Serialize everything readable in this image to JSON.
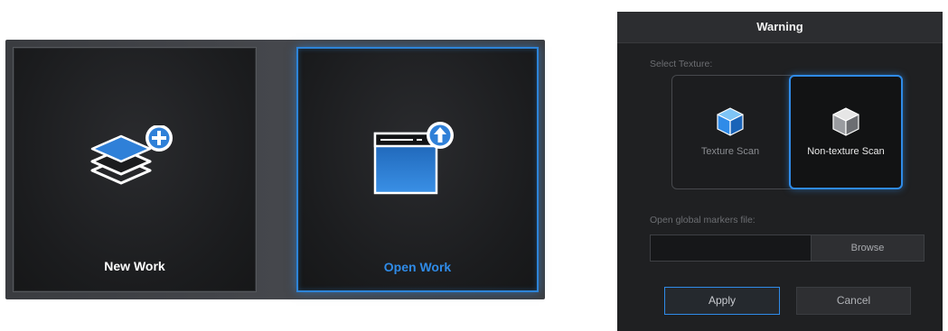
{
  "launcher": {
    "new_work": {
      "label": "New Work",
      "icon": "layers-add-icon"
    },
    "open_work": {
      "label": "Open Work",
      "icon": "window-upload-icon"
    }
  },
  "dialog": {
    "title": "Warning",
    "select_texture_label": "Select Texture:",
    "options": [
      {
        "label": "Texture Scan",
        "icon": "cube-icon-blue",
        "selected": false
      },
      {
        "label": "Non-texture Scan",
        "icon": "cube-icon-gray",
        "selected": true
      }
    ],
    "markers_label": "Open global markers file:",
    "markers_path": "",
    "browse_label": "Browse",
    "apply_label": "Apply",
    "cancel_label": "Cancel"
  },
  "colors": {
    "accent": "#2f8be8",
    "card_bg": "#1b1c1e",
    "dialog_bg": "#1f2022"
  }
}
